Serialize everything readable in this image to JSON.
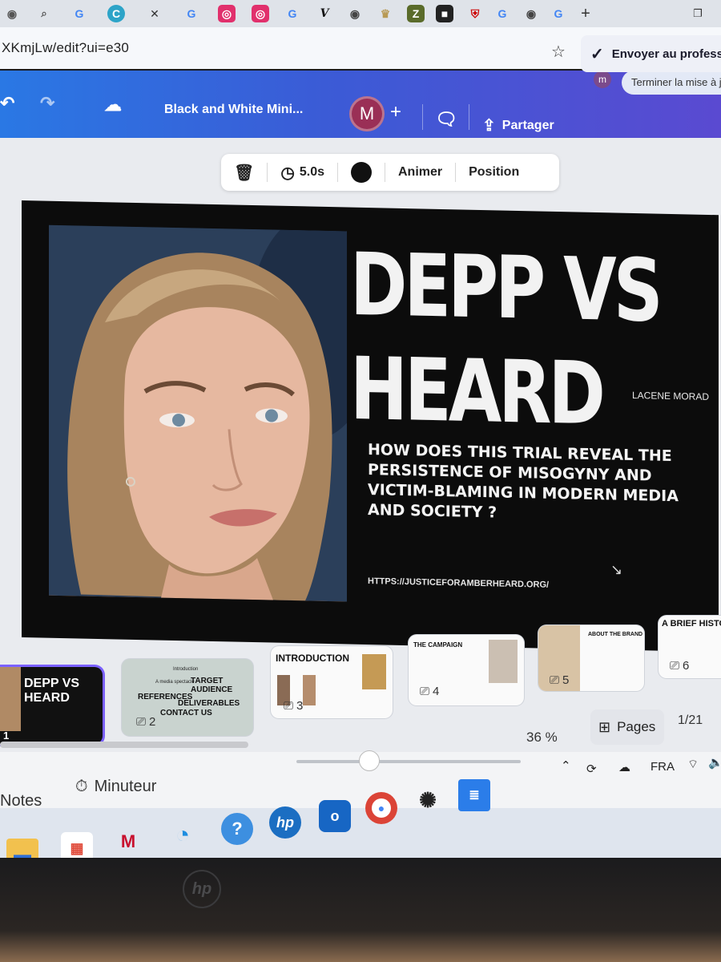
{
  "browser": {
    "url": "XKmjLw/edit?ui=e30",
    "finish_setup": "Terminer la mise à jo",
    "profile_initial": "m"
  },
  "header": {
    "doc_title": "Black and White Mini...",
    "collaborator_initial": "M",
    "share_label": "Partager",
    "send_label": "Envoyer au profess"
  },
  "toolbar": {
    "duration": "5.0s",
    "animate_label": "Animer",
    "position_label": "Position",
    "color": "#111111"
  },
  "slide": {
    "title_line1": "DEPP VS",
    "title_line2": "HEARD",
    "author": "LACENE MORAD",
    "question": "HOW DOES THIS TRIAL REVEAL THE PERSISTENCE OF MISOGYNY AND VICTIM-BLAMING IN MODERN MEDIA AND SOCIETY ?",
    "link": "HTTPS://JUSTICEFORAMBERHEARD.ORG/"
  },
  "thumbnails": [
    {
      "number": "1",
      "title": "DEPP VS HEARD"
    },
    {
      "number": "2",
      "lines": [
        "Introduction",
        "A media spectacle",
        "TARGET AUDIENCE",
        "REFERENCES",
        "DELIVERABLES",
        "CONTACT US"
      ]
    },
    {
      "number": "3",
      "title": "INTRODUCTION"
    },
    {
      "number": "4",
      "title": "THE CAMPAIGN"
    },
    {
      "number": "5",
      "title": "ABOUT THE BRAND"
    },
    {
      "number": "6",
      "title": "A BRIEF HISTORY"
    }
  ],
  "footer": {
    "zoom": "36 %",
    "pages_label": "Pages",
    "page_count": "1/21",
    "notes_label": "Notes",
    "timer_label": "Minuteur"
  },
  "system": {
    "language": "FRA"
  }
}
